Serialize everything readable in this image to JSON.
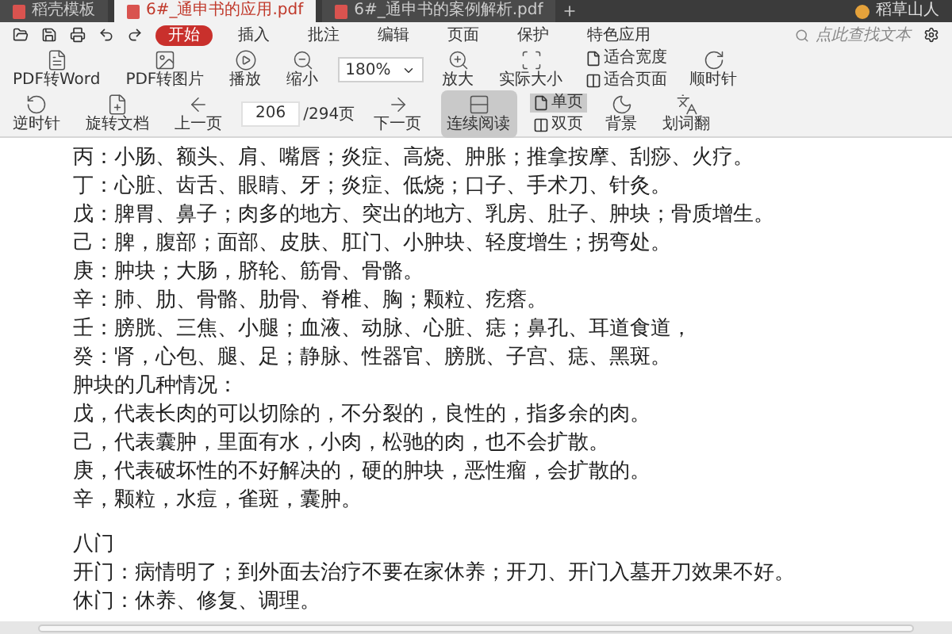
{
  "tabs": [
    {
      "label": "稻壳模板",
      "selected": false
    },
    {
      "label": "6#_通申书的应用.pdf",
      "selected": true
    },
    {
      "label": "6#_通申书的案例解析.pdf",
      "selected": false
    }
  ],
  "user": {
    "name": "稻草山人"
  },
  "menu": [
    {
      "label": "开始",
      "selected": true
    },
    {
      "label": "插入",
      "selected": false
    },
    {
      "label": "批注",
      "selected": false
    },
    {
      "label": "编辑",
      "selected": false
    },
    {
      "label": "页面",
      "selected": false
    },
    {
      "label": "保护",
      "selected": false
    },
    {
      "label": "特色应用",
      "selected": false
    }
  ],
  "search": {
    "placeholder": "点此查找文本"
  },
  "toolbar": [
    {
      "kind": "button",
      "label": "PDF转Word"
    },
    {
      "kind": "button",
      "label": "PDF转图片"
    },
    {
      "kind": "button",
      "label": "播放"
    },
    {
      "kind": "button",
      "label": "缩小"
    },
    {
      "kind": "zoom",
      "value": "180%"
    },
    {
      "kind": "button",
      "label": "放大"
    },
    {
      "kind": "button",
      "label": "实际大小"
    },
    {
      "kind": "stack",
      "items": [
        {
          "label": "适合宽度",
          "selected": false
        },
        {
          "label": "适合页面",
          "selected": false
        }
      ]
    },
    {
      "kind": "button",
      "label": "顺时针"
    },
    {
      "kind": "break"
    },
    {
      "kind": "button",
      "label": "逆时针"
    },
    {
      "kind": "button",
      "label": "旋转文档"
    },
    {
      "kind": "button",
      "label": "上一页"
    },
    {
      "kind": "page",
      "value": "206",
      "total": "/294页"
    },
    {
      "kind": "button",
      "label": "下一页"
    },
    {
      "kind": "toggle",
      "label": "连续阅读",
      "selected": true
    },
    {
      "kind": "stack",
      "items": [
        {
          "label": "单页",
          "selected": true
        },
        {
          "label": "双页",
          "selected": false
        }
      ]
    },
    {
      "kind": "button",
      "label": "背景"
    },
    {
      "kind": "button",
      "label": "划词翻"
    }
  ],
  "sections": [
    [
      "丙：小肠、额头、肩、嘴唇；炎症、高烧、肿胀；推拿按摩、刮痧、火疗。",
      "丁：心脏、齿舌、眼睛、牙；炎症、低烧；口子、手术刀、针灸。",
      "戊：脾胃、鼻子；肉多的地方、突出的地方、乳房、肚子、肿块；骨质增生。",
      "己：脾，腹部；面部、皮肤、肛门、小肿块、轻度增生；拐弯处。",
      "庚：肿块；大肠，脐轮、筋骨、骨骼。",
      "辛：肺、肋、骨骼、肋骨、脊椎、胸；颗粒、疙瘩。",
      "壬：膀胱、三焦、小腿；血液、动脉、心脏、痣；鼻孔、耳道食道，",
      "癸：肾，心包、腿、足；静脉、性器官、膀胱、子宫、痣、黑斑。",
      "肿块的几种情况：",
      "戊，代表长肉的可以切除的，不分裂的，良性的，指多余的肉。",
      "己，代表囊肿，里面有水，小肉，松驰的肉，也不会扩散。",
      "庚，代表破坏性的不好解决的，硬的肿块，恶性瘤，会扩散的。",
      "辛，颗粒，水痘，雀斑，囊肿。"
    ],
    [
      "八门",
      "开门：病情明了；到外面去治疗不要在家休养；开刀、开门入墓开刀效果不好。",
      "休门：休养、修复、调理。"
    ]
  ]
}
